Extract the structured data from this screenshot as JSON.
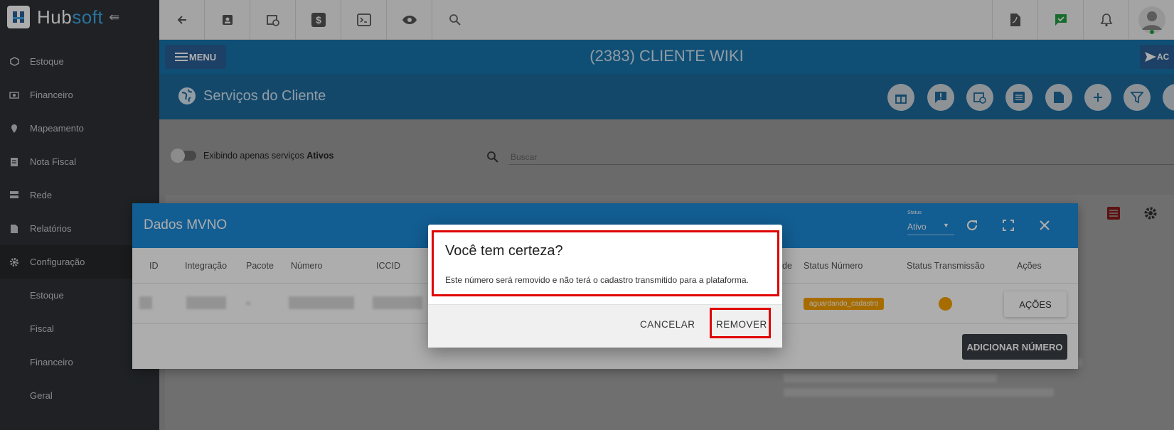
{
  "app": {
    "logo_text_a": "Hub",
    "logo_text_b": "soft"
  },
  "sidebar": {
    "items": [
      {
        "label": "Estoque",
        "icon": "box-icon"
      },
      {
        "label": "Financeiro",
        "icon": "money-icon"
      },
      {
        "label": "Mapeamento",
        "icon": "map-pin-icon"
      },
      {
        "label": "Nota Fiscal",
        "icon": "document-icon"
      },
      {
        "label": "Rede",
        "icon": "server-icon"
      },
      {
        "label": "Relatórios",
        "icon": "report-icon"
      },
      {
        "label": "Configuração",
        "icon": "gear-icon"
      }
    ],
    "subitems": [
      {
        "label": "Estoque"
      },
      {
        "label": "Fiscal"
      },
      {
        "label": "Financeiro"
      },
      {
        "label": "Geral"
      }
    ]
  },
  "header": {
    "menu_label": "MENU",
    "client_title": "(2383) CLIENTE WIKI",
    "ac_label": "AC"
  },
  "section": {
    "title": "Serviços do Cliente"
  },
  "filter": {
    "toggle_text": "Exibindo apenas serviços",
    "toggle_bold": "Ativos",
    "search_placeholder": "Buscar"
  },
  "mvno_modal": {
    "title": "Dados MVNO",
    "status_label": "Status",
    "status_value": "Ativo",
    "columns": [
      "ID",
      "Integração",
      "Pacote",
      "Número",
      "ICCID",
      "de",
      "Status Número",
      "Status Transmissão",
      "Ações"
    ],
    "row": {
      "status_numero": "aguardando_cadastro",
      "acoes_label": "AÇÕES"
    },
    "add_button": "ADICIONAR NÚMERO",
    "colors": {
      "header": "#1b8ad8",
      "badge": "#f7a000"
    }
  },
  "confirm_dialog": {
    "title": "Você tem certeza?",
    "message": "Este número será removido e não terá o cadastro transmitido para a plataforma.",
    "cancel_label": "CANCELAR",
    "remove_label": "REMOVER",
    "highlight_color": "#e00000"
  }
}
